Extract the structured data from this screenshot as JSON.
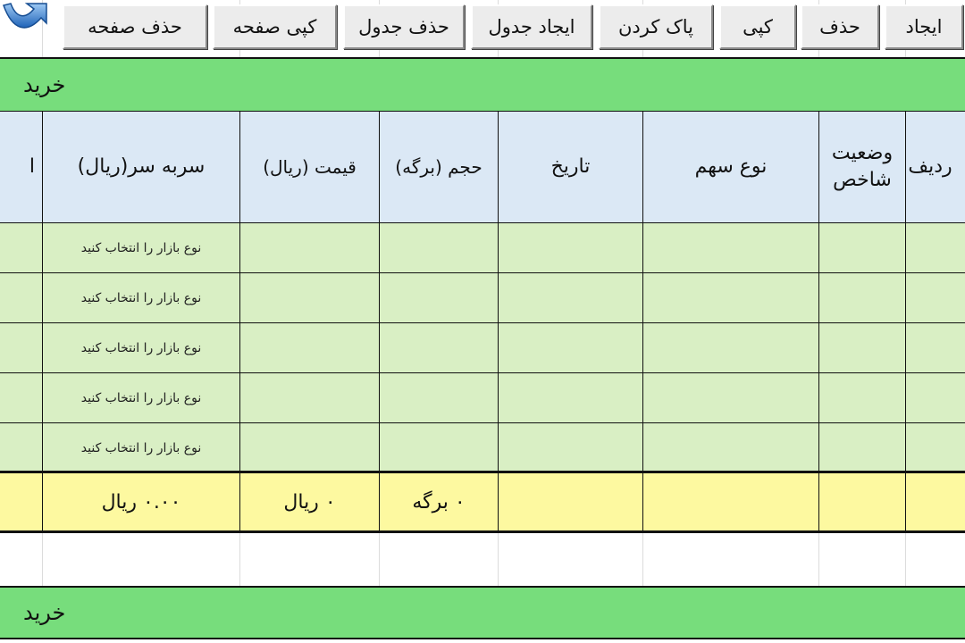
{
  "toolbar": {
    "buttons": [
      {
        "label": "ایجاد"
      },
      {
        "label": "حذف"
      },
      {
        "label": "کپی"
      },
      {
        "label": "پاک کردن"
      },
      {
        "label": "ایجاد جدول"
      },
      {
        "label": "حذف جدول"
      },
      {
        "label": "کپی صفحه"
      },
      {
        "label": "حذف صفحه"
      }
    ]
  },
  "sections": [
    {
      "title": "خرید"
    },
    {
      "title": "خرید"
    }
  ],
  "table": {
    "headers": {
      "row_no": "ردیف",
      "index_status": "وضعیت شاخص",
      "stock_type": "نوع سهم",
      "date": "تاریخ",
      "volume": "حجم (برگه)",
      "price": "قیمت (ریال)",
      "break_even": "سربه سر(ریال)",
      "partial": "ا"
    },
    "row_hint": "نوع بازار را انتخاب کنید",
    "rows": 5,
    "totals": {
      "volume": "۰ برگه",
      "price": "۰ ریال",
      "break_even": "۰.۰۰ ریال"
    }
  }
}
